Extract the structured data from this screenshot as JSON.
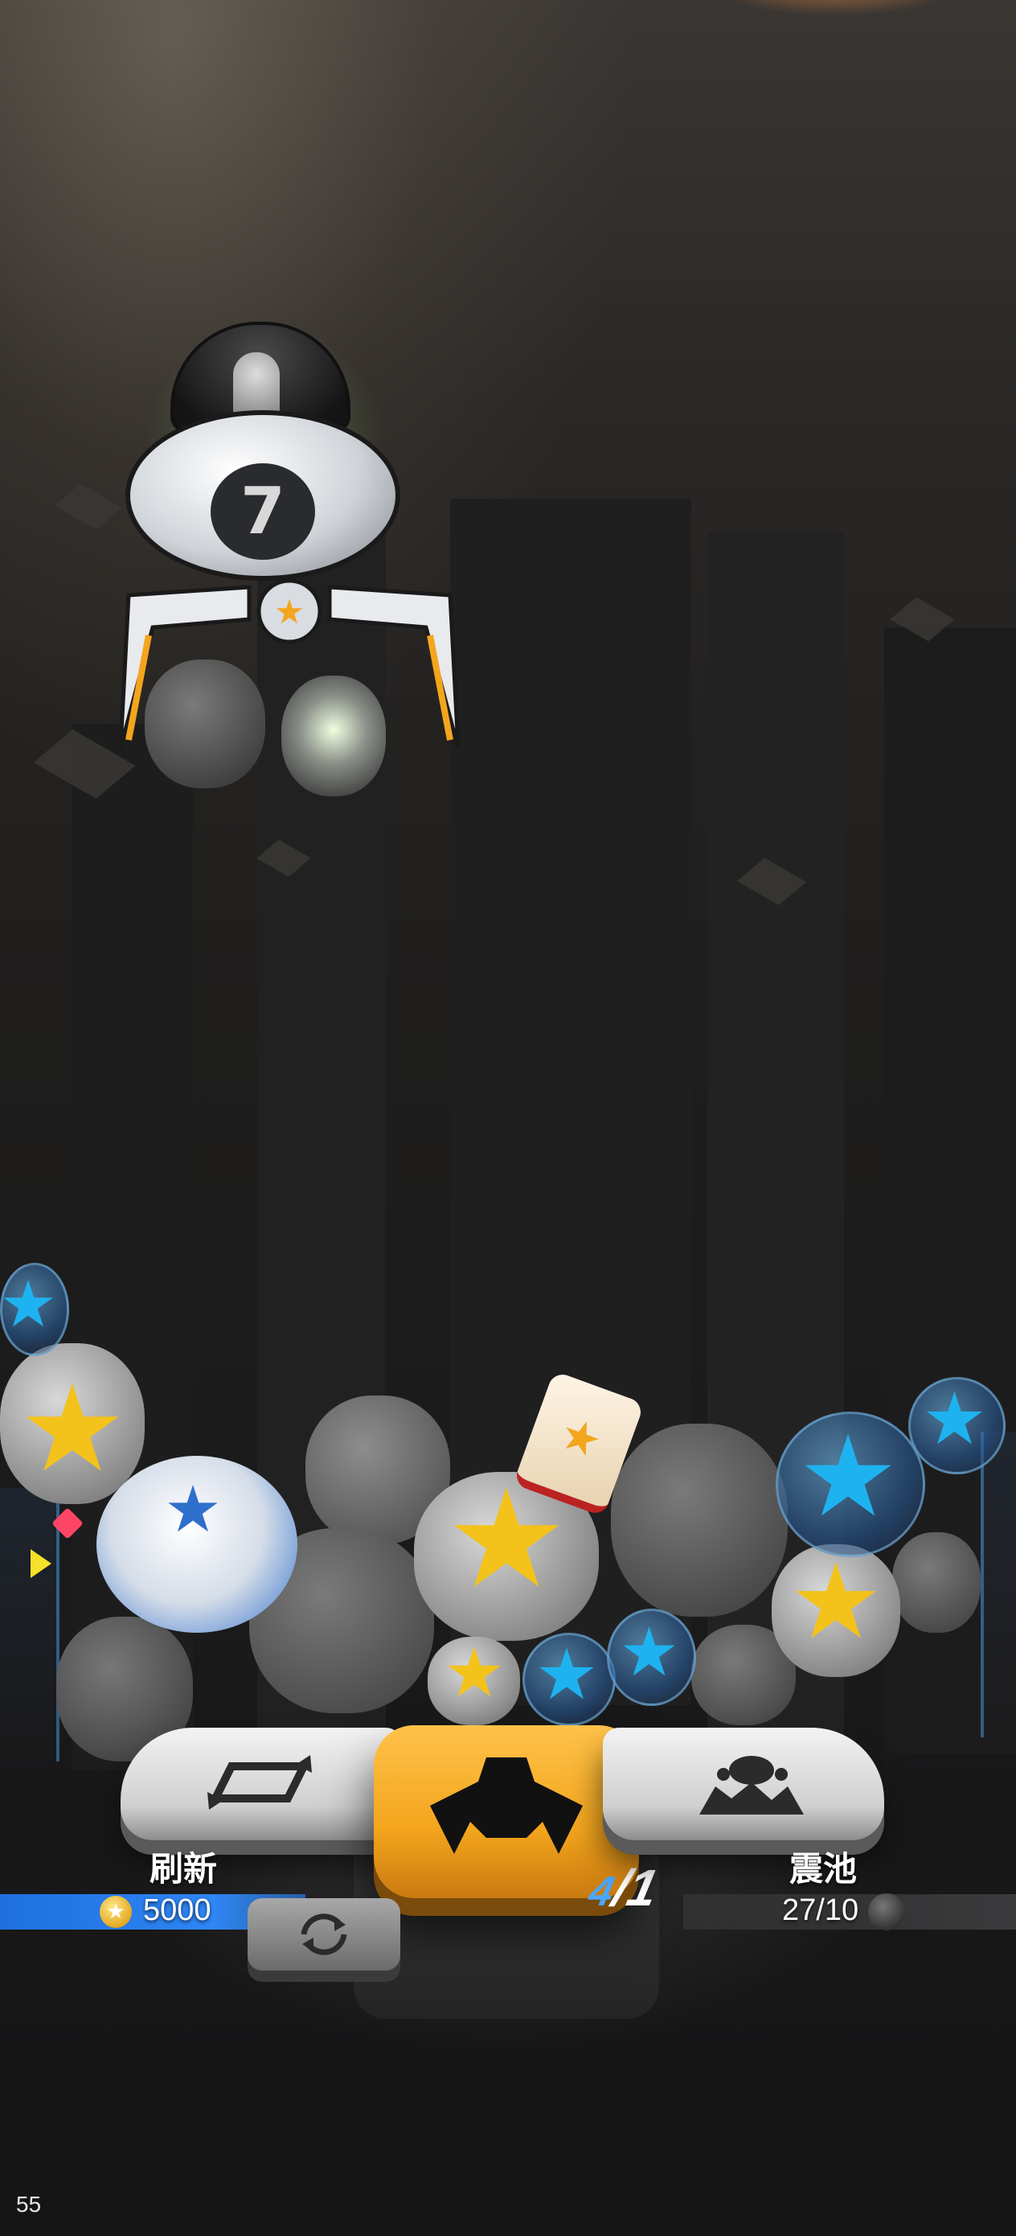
{
  "hud": {
    "refresh": {
      "label": "刷新",
      "cost": "5000",
      "icon": "rectangle-refresh-icon",
      "currency_icon": "star-coin-icon"
    },
    "pool": {
      "label": "震池",
      "value": "27/10",
      "icon": "pool-icon",
      "resource_icon": "ore-icon"
    },
    "grab": {
      "icon": "claw-grab-icon",
      "count_current": "4",
      "count_sep": "/",
      "count_max": "1"
    },
    "swap": {
      "icon": "swap-claw-icon"
    },
    "fps": "55"
  },
  "claw_machine": {
    "badge_number": "7"
  },
  "colors": {
    "accent_orange": "#f3a51d",
    "bar_blue": "#2f86f5",
    "gold_star": "#f3c21b",
    "cyan_star": "#1eb3f0"
  }
}
